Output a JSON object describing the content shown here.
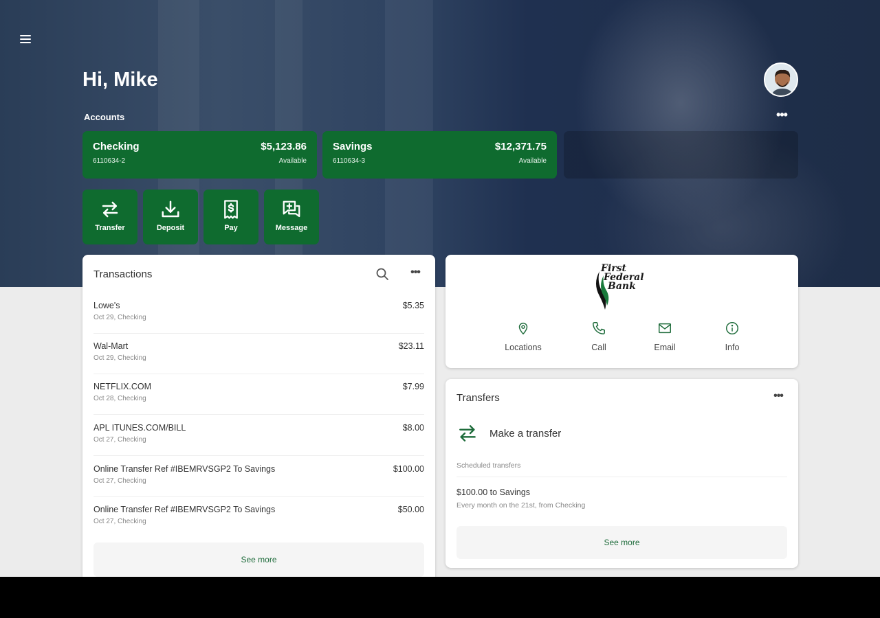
{
  "header": {
    "greeting": "Hi, Mike",
    "accounts_label": "Accounts",
    "more_label": "•••"
  },
  "accounts": [
    {
      "name": "Checking",
      "number": "6110634-2",
      "balance": "$5,123.86",
      "status": "Available"
    },
    {
      "name": "Savings",
      "number": "6110634-3",
      "balance": "$12,371.75",
      "status": "Available"
    }
  ],
  "actions": [
    {
      "label": "Transfer",
      "icon": "transfer-icon"
    },
    {
      "label": "Deposit",
      "icon": "deposit-icon"
    },
    {
      "label": "Pay",
      "icon": "pay-icon"
    },
    {
      "label": "Message",
      "icon": "message-icon"
    }
  ],
  "transactions": {
    "title": "Transactions",
    "more_label": "•••",
    "items": [
      {
        "desc": "Lowe's",
        "meta": "Oct 29, Checking",
        "amount": "$5.35"
      },
      {
        "desc": "Wal-Mart",
        "meta": "Oct 29, Checking",
        "amount": "$23.11"
      },
      {
        "desc": "NETFLIX.COM",
        "meta": "Oct 28, Checking",
        "amount": "$7.99"
      },
      {
        "desc": "APL ITUNES.COM/BILL",
        "meta": "Oct 27, Checking",
        "amount": "$8.00"
      },
      {
        "desc": "Online Transfer Ref #IBEMRVSGP2 To Savings",
        "meta": "Oct 27, Checking",
        "amount": "$100.00"
      },
      {
        "desc": "Online Transfer Ref #IBEMRVSGP2 To Savings",
        "meta": "Oct 27, Checking",
        "amount": "$50.00"
      }
    ],
    "see_more": "See more"
  },
  "bank": {
    "logo_text": [
      "First",
      "Federal",
      "Bank"
    ],
    "contacts": [
      {
        "label": "Locations",
        "icon": "location-pin-icon"
      },
      {
        "label": "Call",
        "icon": "phone-icon"
      },
      {
        "label": "Email",
        "icon": "email-icon"
      },
      {
        "label": "Info",
        "icon": "info-icon"
      }
    ]
  },
  "transfers": {
    "title": "Transfers",
    "more_label": "•••",
    "make_transfer": "Make a transfer",
    "scheduled_label": "Scheduled transfers",
    "scheduled": [
      {
        "title": "$100.00 to Savings",
        "subtitle": "Every month on the 21st, from Checking"
      }
    ],
    "see_more": "See more"
  },
  "colors": {
    "brand_green": "#0f6b2f",
    "link_green": "#1d6b3a",
    "hero_navy": "#2a3d57"
  }
}
